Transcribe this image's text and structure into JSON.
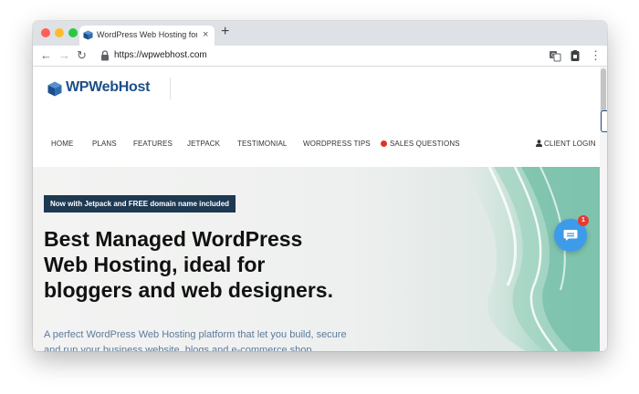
{
  "browser": {
    "tab_title": "WordPress Web Hosting for Bl",
    "tab_close": "×",
    "new_tab": "+",
    "back": "←",
    "forward": "→",
    "reload": "↻",
    "url": "https://wpwebhost.com",
    "more": "⋮"
  },
  "site": {
    "logo_text": "WPWebHost",
    "nav": [
      {
        "label": "HOME"
      },
      {
        "label": "PLANS"
      },
      {
        "label": "FEATURES"
      },
      {
        "label": "JETPACK"
      },
      {
        "label": "TESTIMONIAL"
      },
      {
        "label": "WORDPRESS TIPS"
      },
      {
        "label": "SALES QUESTIONS"
      },
      {
        "label": "CLIENT LOGIN"
      }
    ],
    "client_icon": "user-icon",
    "badge": "Now with Jetpack and FREE domain name included",
    "headline": "Best Managed WordPress Web Hosting, ideal for bloggers and web designers.",
    "subtext": "A perfect WordPress Web Hosting platform that let you build, secure and run your business website, blogs and e-commerce shop.",
    "chat_badge": "1"
  },
  "colors": {
    "brand": "#1c4f89",
    "badge_bg": "#1e3952",
    "chat": "#3d9be9",
    "notify": "#e53935"
  }
}
